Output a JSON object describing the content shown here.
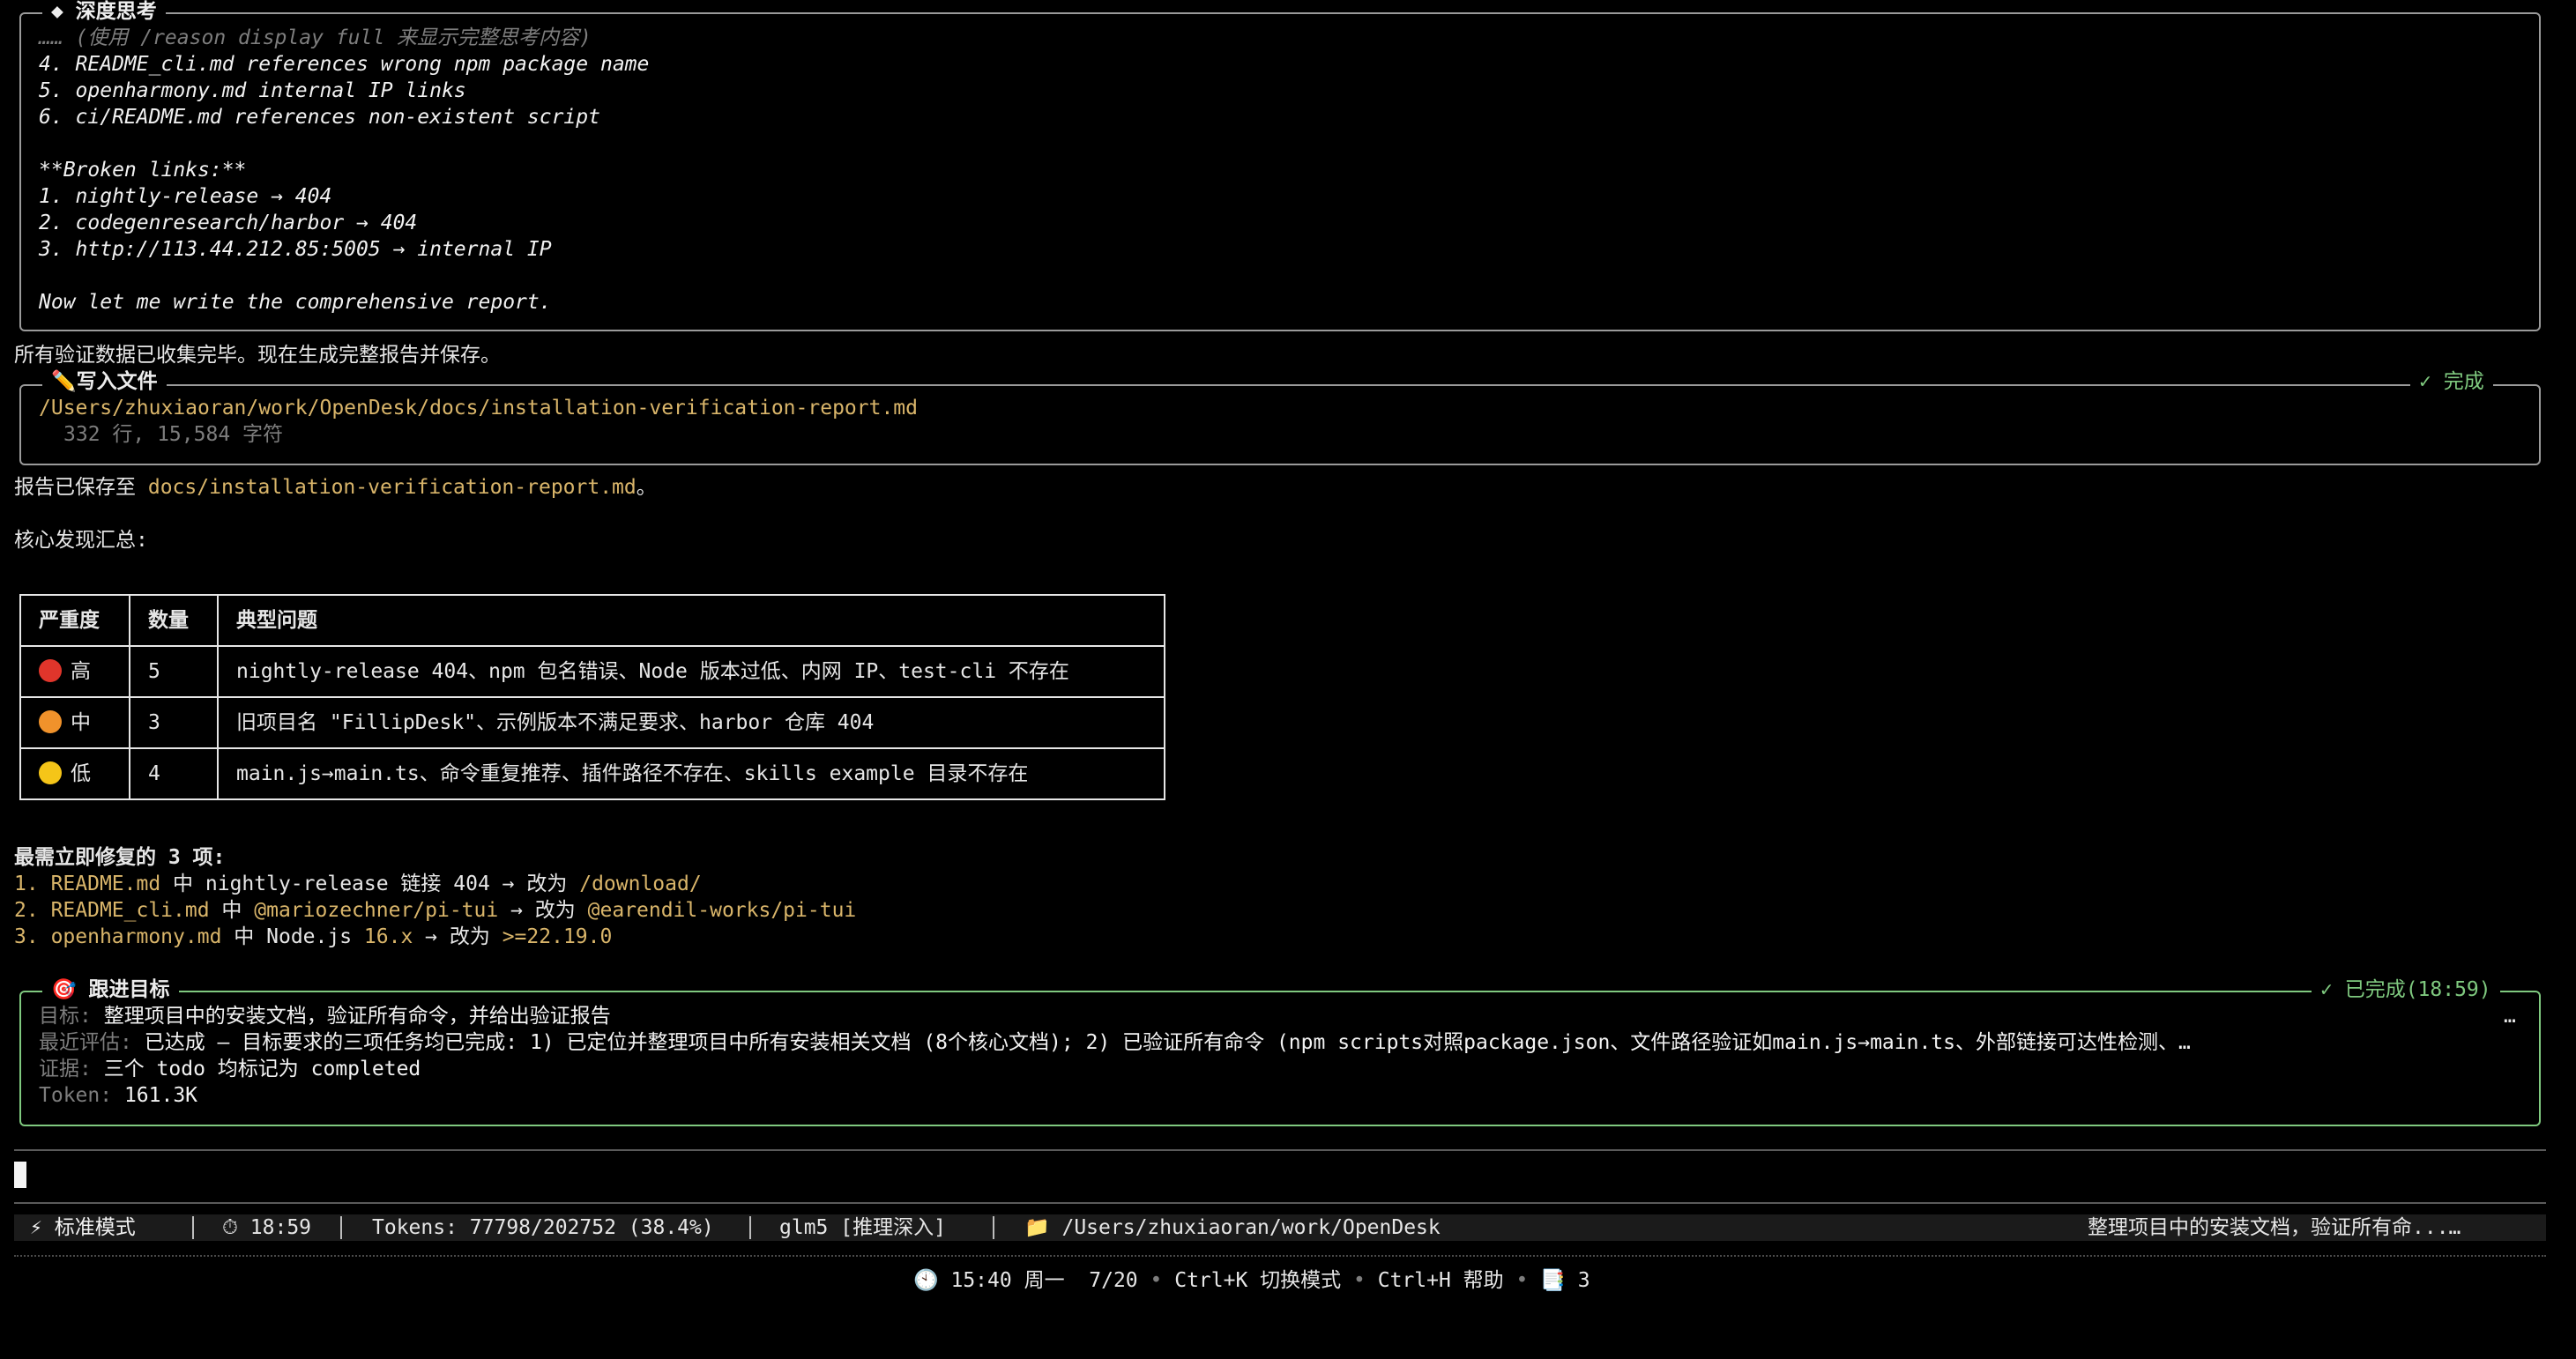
{
  "thinking_panel": {
    "title": "◆ 深度思考",
    "hint": "…… (使用 /reason display full 来显示完整思考内容)",
    "lines": [
      "4. README_cli.md references wrong npm package name",
      "5. openharmony.md internal IP links",
      "6. ci/README.md references non-existent script",
      "",
      "**Broken links:**",
      "1. nightly-release → 404",
      "2. codegenresearch/harbor → 404",
      "3. http://113.44.212.85:5005 → internal IP",
      "",
      "Now let me write the comprehensive report."
    ]
  },
  "msg_collected": "所有验证数据已收集完毕。现在生成完整报告并保存。",
  "write_panel": {
    "title": "✏️写入文件",
    "status": "✓ 完成",
    "path": "/Users/zhuxiaoran/work/OpenDesk/docs/installation-verification-report.md",
    "meta": "332 行, 15,584 字符"
  },
  "saved_msg": {
    "prefix": "报告已保存至 ",
    "path": "docs/installation-verification-report.md",
    "suffix": "。"
  },
  "summary_heading": "核心发现汇总:",
  "table": {
    "headers": [
      "严重度",
      "数量",
      "典型问题"
    ],
    "rows": [
      {
        "dot_color": "#e0352b",
        "severity": "高",
        "count": "5",
        "issue": "nightly-release 404、npm 包名错误、Node 版本过低、内网 IP、test-cli 不存在"
      },
      {
        "dot_color": "#f0922b",
        "severity": "中",
        "count": "3",
        "issue": "旧项目名 \"FillipDesk\"、示例版本不满足要求、harbor 仓库 404"
      },
      {
        "dot_color": "#f5c518",
        "severity": "低",
        "count": "4",
        "issue": "main.js→main.ts、命令重复推荐、插件路径不存在、skills example 目录不存在"
      }
    ]
  },
  "fix_heading": "最需立即修复的 3 项:",
  "fixes": [
    {
      "num": "1.",
      "file": "README.md",
      "mid": " 中 nightly-release 链接 404 → 改为 ",
      "target": "/download/"
    },
    {
      "num": "2.",
      "file": "README_cli.md",
      "mid": " 中 ",
      "code": "@mariozechner/pi-tui",
      "mid2": " → 改为 ",
      "target": "@earendil-works/pi-tui"
    },
    {
      "num": "3.",
      "file": "openharmony.md",
      "mid": " 中 Node.js ",
      "code": "16.x",
      "mid2": " → 改为 ",
      "target": ">=22.19.0"
    }
  ],
  "goal_panel": {
    "title": "🎯 跟进目标",
    "status": "✓ 已完成(18:59)",
    "goal_label": "目标:",
    "goal_text": " 整理项目中的安装文档，验证所有命令，并给出验证报告",
    "goal_trunc": "…",
    "eval_label": "最近评估:",
    "eval_text": " 已达成 – 目标要求的三项任务均已完成: 1) 已定位并整理项目中所有安装相关文档 (8个核心文档); 2) 已验证所有命令 (npm scripts对照package.json、文件路径验证如main.js→main.ts、外部链接可达性检测、…",
    "evidence_label": "证据:",
    "evidence_text": " 三个 todo 均标记为 completed",
    "token_label": "Token:",
    "token_text": " 161.3K"
  },
  "statusbar": {
    "mode": "⚡ 标准模式",
    "time": "⏱ 18:59",
    "tokens": "Tokens: 77798/202752 (38.4%)",
    "model": "glm5 [推理深入]",
    "path": "📁 /Users/zhuxiaoran/work/OpenDesk",
    "task": "整理项目中的安装文档，验证所有命...…"
  },
  "footer": {
    "clock": "🕙 15:40 周一  7/20",
    "sep": "•",
    "switch_mode": "Ctrl+K 切换模式",
    "help": "Ctrl+H 帮助",
    "notice": "📑 3"
  }
}
